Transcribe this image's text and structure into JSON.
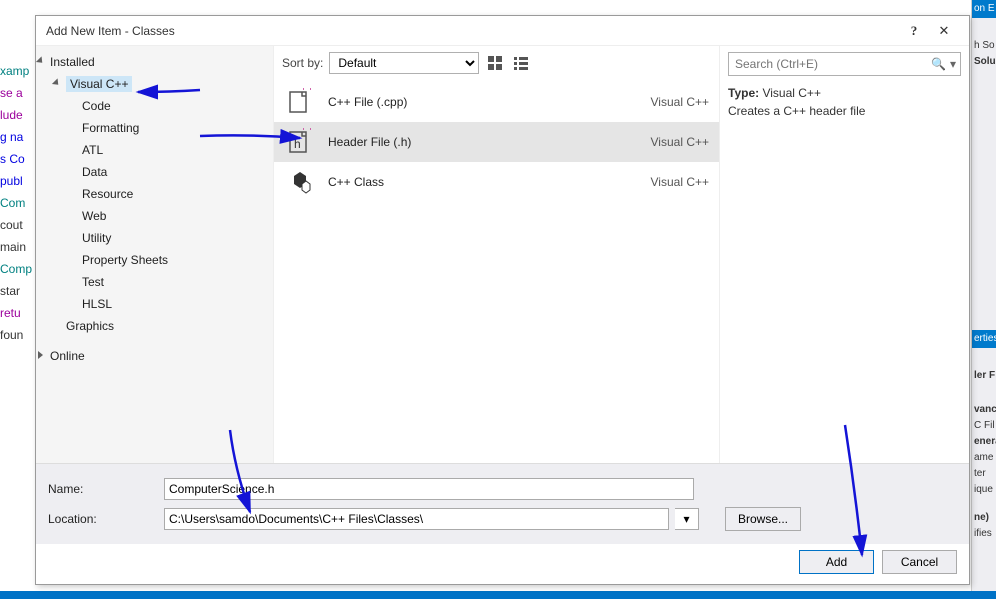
{
  "dialog": {
    "title": "Add New Item - Classes",
    "help": "?",
    "close": "✕"
  },
  "tree": {
    "root": "Installed",
    "selected": "Visual C++",
    "items": [
      "Code",
      "Formatting",
      "ATL",
      "Data",
      "Resource",
      "Web",
      "Utility",
      "Property Sheets",
      "Test",
      "HLSL"
    ],
    "sibling": "Graphics",
    "online": "Online"
  },
  "sort": {
    "label": "Sort by:",
    "value": "Default"
  },
  "list": {
    "items": [
      {
        "icon": "cpp-file-icon",
        "name": "C++ File (.cpp)",
        "cat": "Visual C++"
      },
      {
        "icon": "header-file-icon",
        "name": "Header File (.h)",
        "cat": "Visual C++"
      },
      {
        "icon": "cpp-class-icon",
        "name": "C++ Class",
        "cat": "Visual C++"
      }
    ],
    "selected_index": 1
  },
  "search": {
    "placeholder": "Search (Ctrl+E)"
  },
  "details": {
    "type_label": "Type:",
    "type_value": "Visual C++",
    "desc": "Creates a C++ header file"
  },
  "form": {
    "name_label": "Name:",
    "name_value": "ComputerScience.h",
    "location_label": "Location:",
    "location_value": "C:\\Users\\samdo\\Documents\\C++ Files\\Classes\\",
    "browse": "Browse...",
    "add": "Add",
    "cancel": "Cancel"
  },
  "bg_code": [
    "xamp",
    "se a",
    "lude",
    "g na",
    "",
    "s Co",
    "",
    "publ",
    "",
    "",
    "",
    "Com",
    "",
    "cout",
    "",
    "",
    "main",
    "",
    "Comp",
    "star",
    "retu",
    "",
    "foun"
  ],
  "right_strip": {
    "top": "on E",
    "srch": "h So",
    "solu": "Solu",
    "props": "erties",
    "hf": "ler F",
    "adv": "vance",
    "cfile": "C Fil",
    "gen": "enera",
    "nm": "ame",
    "ter": "ter",
    "iq": "ique",
    "ne": "ne)",
    "ifi": "ifies"
  }
}
